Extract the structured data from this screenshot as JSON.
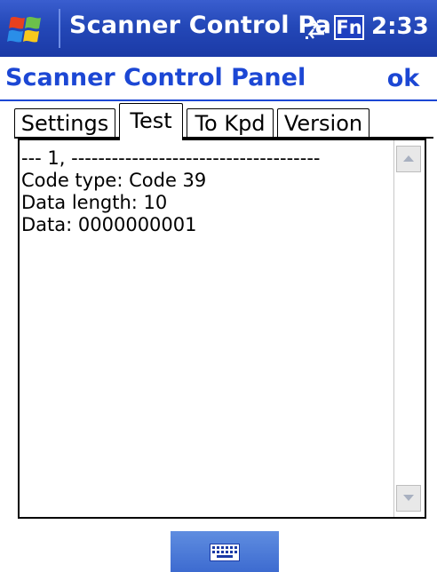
{
  "titlebar": {
    "app_title": "Scanner Control Pa",
    "fn_label": "Fn",
    "time": "2:33",
    "start_icon": "windows-flag-icon",
    "connectivity_icon": "connectivity-arrows-icon"
  },
  "panel": {
    "title": "Scanner Control Panel",
    "ok_label": "ok"
  },
  "tabs": [
    {
      "label": "Settings",
      "active": false
    },
    {
      "label": "Test",
      "active": true
    },
    {
      "label": "To Kpd",
      "active": false
    },
    {
      "label": "Version",
      "active": false
    }
  ],
  "log": {
    "lines": [
      "--- 1, -------------------------------------",
      "Code type: Code 39",
      "Data length: 10",
      "Data: 0000000001"
    ]
  },
  "bottombar": {
    "keyboard_icon": "keyboard-icon"
  },
  "colors": {
    "titlebar_blue": "#2448b8",
    "accent_blue": "#1c47d4",
    "keyboard_button_blue": "#4a78d8"
  }
}
